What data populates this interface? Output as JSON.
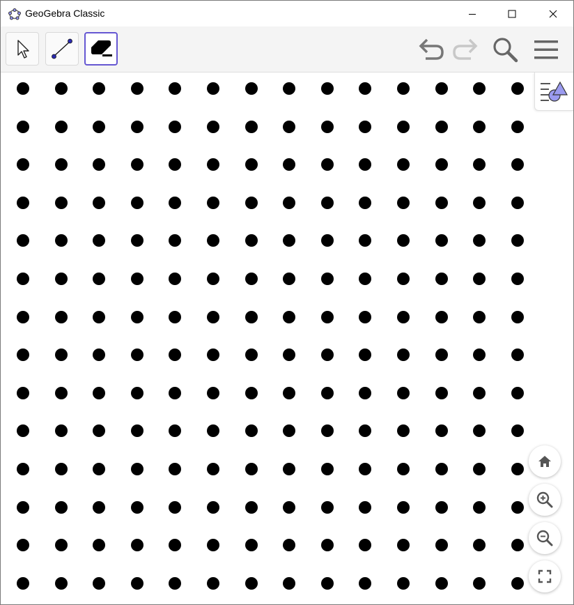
{
  "window": {
    "title": "GeoGebra Classic",
    "icons": {
      "app": "geogebra-logo-icon",
      "minimize": "minimize-icon",
      "maximize": "maximize-icon",
      "close": "close-icon"
    }
  },
  "toolbar": {
    "tools": [
      {
        "name": "move-tool",
        "icon": "cursor-arrow-icon",
        "selected": false
      },
      {
        "name": "segment-tool",
        "icon": "segment-icon",
        "selected": false
      },
      {
        "name": "delete-tool",
        "icon": "eraser-icon",
        "selected": true
      }
    ],
    "right_buttons": [
      {
        "name": "undo-button",
        "icon": "undo-icon"
      },
      {
        "name": "redo-button",
        "icon": "redo-icon"
      },
      {
        "name": "search-button",
        "icon": "search-icon"
      },
      {
        "name": "menu-button",
        "icon": "hamburger-menu-icon"
      }
    ],
    "accent_color": "#6557d2"
  },
  "graphics": {
    "style_bar_toggle_icon": "style-bar-icon",
    "point_grid": {
      "rows": 14,
      "cols": 14,
      "color": "#000000"
    },
    "view_buttons": [
      {
        "name": "home-button",
        "icon": "home-icon"
      },
      {
        "name": "zoom-in-button",
        "icon": "zoom-in-icon"
      },
      {
        "name": "zoom-out-button",
        "icon": "zoom-out-icon"
      },
      {
        "name": "fullscreen-button",
        "icon": "fullscreen-icon"
      }
    ]
  }
}
